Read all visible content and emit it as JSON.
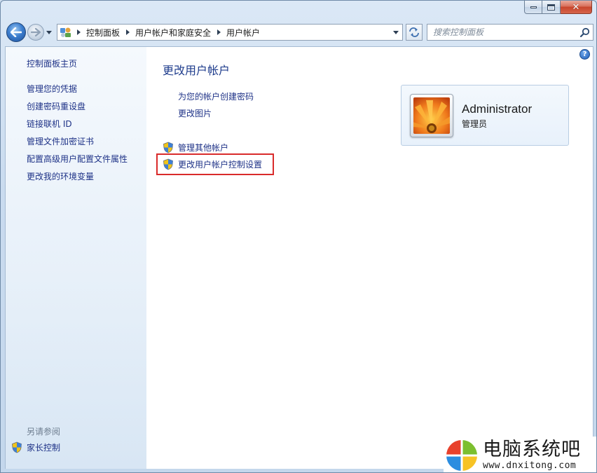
{
  "window": {
    "minimize_label": "minimize",
    "maximize_label": "maximize",
    "close_label": "close"
  },
  "address_bar": {
    "breadcrumbs": [
      "控制面板",
      "用户帐户和家庭安全",
      "用户帐户"
    ]
  },
  "search": {
    "placeholder": "搜索控制面板"
  },
  "sidebar": {
    "home": "控制面板主页",
    "links": [
      "管理您的凭据",
      "创建密码重设盘",
      "链接联机 ID",
      "管理文件加密证书",
      "配置高级用户配置文件属性",
      "更改我的环境变量"
    ],
    "see_also": "另请参阅",
    "parental_controls": "家长控制"
  },
  "main": {
    "title": "更改用户帐户",
    "tasks": [
      "为您的帐户创建密码",
      "更改图片"
    ],
    "admin_tasks": [
      "管理其他帐户",
      "更改用户帐户控制设置"
    ],
    "help": "?"
  },
  "user": {
    "name": "Administrator",
    "role": "管理员"
  },
  "watermark": {
    "title": "电脑系统吧",
    "url": "www.dnxitong.com"
  },
  "colors": {
    "link": "#1e3287",
    "title": "#1e3c8c",
    "highlight": "#d92b2b"
  }
}
